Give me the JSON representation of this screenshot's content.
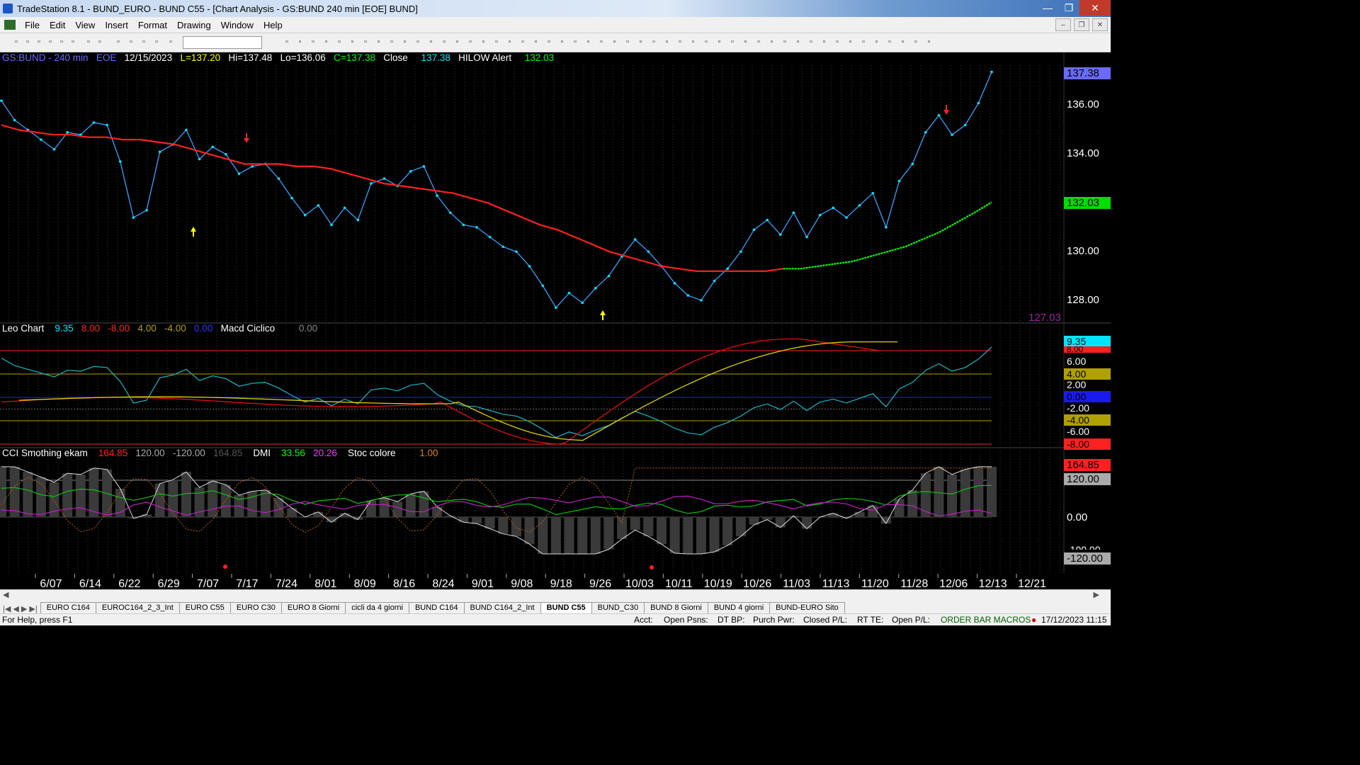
{
  "window": {
    "title": "TradeStation 8.1 - BUND_EURO - BUND C55 - [Chart Analysis - GS:BUND  240 min  [EOE] BUND]"
  },
  "menu": [
    "File",
    "Edit",
    "View",
    "Insert",
    "Format",
    "Drawing",
    "Window",
    "Help"
  ],
  "header1": {
    "symbol": "GS:BUND - 240 min",
    "session": "EOE",
    "date": "12/15/2023",
    "last": "L=137.20",
    "high": "Hi=137.48",
    "low": "Lo=136.06",
    "close": "C=137.38",
    "close_label": "Close",
    "close_value": "137.38",
    "alert_label": "HILOW Alert",
    "alert_value": "132.03"
  },
  "header2": {
    "name": "Leo Chart",
    "v1": "9.35",
    "v2": "8.00",
    "v3": "-8.00",
    "v4": "4.00",
    "v5": "-4.00",
    "v6": "0.00",
    "name2": "Macd Ciclico",
    "v7": "0.00"
  },
  "header3": {
    "name": "CCI Smothing ekam",
    "v1": "164.85",
    "v2": "120.00",
    "v3": "-120.00",
    "v4": "164.85",
    "name2": "DMI",
    "v5": "33.56",
    "v6": "20.26",
    "name3": "Stoc colore",
    "v7": "1.00"
  },
  "price_axis": [
    "136.00",
    "134.00",
    "132.00",
    "130.00",
    "128.00"
  ],
  "price_tags": {
    "last": "137.38",
    "alert": "132.03",
    "low_label": "127.03"
  },
  "osc_axis": [
    "6.00",
    "2.00",
    "-2.00",
    "-6.00"
  ],
  "osc_tags": {
    "value": "9.35",
    "upper": "8.00",
    "upper_mid": "4.00",
    "zero": "0.00",
    "lower_mid": "-4.00",
    "lower": "-8.00"
  },
  "cci_axis": [
    "0.00",
    "-100.00"
  ],
  "cci_tags": {
    "value": "164.85",
    "level": "120.00",
    "low": "-120.00"
  },
  "date_axis": [
    "6/07",
    "6/14",
    "6/22",
    "6/29",
    "7/07",
    "7/17",
    "7/24",
    "8/01",
    "8/09",
    "8/16",
    "8/24",
    "9/01",
    "9/08",
    "9/18",
    "9/26",
    "10/03",
    "10/11",
    "10/19",
    "10/26",
    "11/03",
    "11/13",
    "11/20",
    "11/28",
    "12/06",
    "12/13",
    "12/21"
  ],
  "tabs": [
    "EURO C164",
    "EUROC164_2_3_Int",
    "EURO C55",
    "EURO C30",
    "EURO 8 Giorni",
    "cicli da 4 giorni",
    "BUND C164",
    "BUND C164_2_Int",
    "BUND C55",
    "BUND_C30",
    "BUND 8 Giorni",
    "BUND 4 giorni",
    "BUND-EURO Sito"
  ],
  "active_tab": "BUND C55",
  "status": {
    "help": "For Help, press F1",
    "acct": "Acct:",
    "open_psns": "Open Psns:",
    "dtbp": "DT BP:",
    "purch": "Purch Pwr:",
    "closed": "Closed P/L:",
    "rtte": "RT TE:",
    "openpl": "Open P/L:",
    "macros": "ORDER BAR  MACROS",
    "datetime": "17/12/2023 11:15"
  },
  "chart_data": {
    "type": "line",
    "series": [
      {
        "name": "Close",
        "values": [
          136.2,
          135.4,
          135.0,
          134.6,
          134.2,
          134.9,
          134.8,
          135.3,
          135.2,
          133.7,
          131.4,
          131.7,
          134.1,
          134.4,
          135.0,
          133.8,
          134.3,
          134.0,
          133.2,
          133.5,
          133.6,
          133.0,
          132.2,
          131.5,
          131.9,
          131.1,
          131.8,
          131.3,
          132.8,
          133.0,
          132.7,
          133.3,
          133.5,
          132.3,
          131.6,
          131.1,
          131.0,
          130.6,
          130.2,
          130.0,
          129.4,
          128.6,
          127.7,
          128.3,
          127.9,
          128.5,
          129.0,
          129.8,
          130.5,
          130.0,
          129.4,
          128.7,
          128.2,
          128.0,
          128.8,
          129.3,
          130.0,
          130.9,
          131.3,
          130.7,
          131.6,
          130.6,
          131.5,
          131.8,
          131.4,
          131.9,
          132.4,
          131.0,
          132.9,
          133.6,
          134.9,
          135.6,
          134.8,
          135.2,
          136.1,
          137.38
        ]
      },
      {
        "name": "HILOW Alert",
        "values": [
          135.2,
          135.0,
          134.9,
          134.8,
          134.8,
          134.7,
          134.7,
          134.6,
          134.6,
          134.5,
          134.4,
          134.2,
          134.0,
          133.8,
          133.6,
          133.6,
          133.6,
          133.5,
          133.5,
          133.4,
          133.2,
          133.0,
          132.8,
          132.7,
          132.6,
          132.5,
          132.4,
          132.2,
          132.0,
          131.7,
          131.4,
          131.1,
          130.9,
          130.6,
          130.3,
          130.0,
          129.8,
          129.6,
          129.4,
          129.3,
          129.2,
          129.2,
          129.2,
          129.2,
          129.2,
          129.3,
          129.3,
          129.4,
          129.5,
          129.6,
          129.8,
          130.0,
          130.2,
          130.5,
          130.8,
          131.2,
          131.6,
          132.03
        ]
      }
    ]
  }
}
